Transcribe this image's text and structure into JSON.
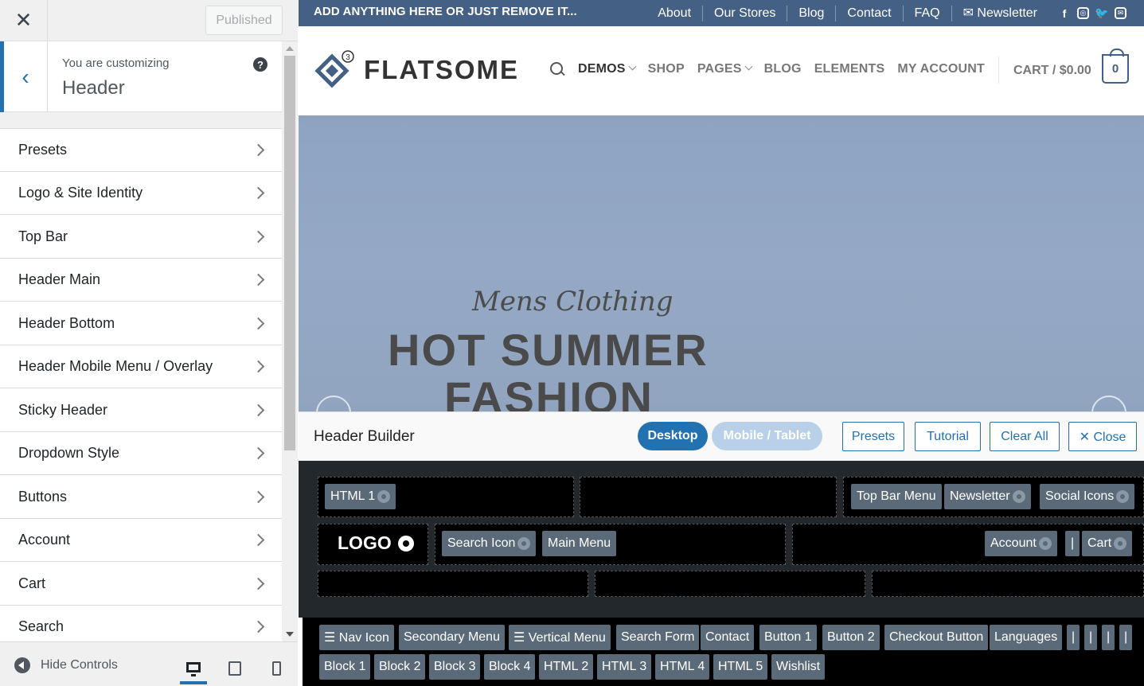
{
  "sidebar": {
    "close_icon": "close-icon",
    "published_label": "Published",
    "customizing_label": "You are customizing",
    "customizing_title": "Header",
    "help_glyph": "?",
    "sections": [
      "Presets",
      "Logo & Site Identity",
      "Top Bar",
      "Header Main",
      "Header Bottom",
      "Header Mobile Menu / Overlay",
      "Sticky Header",
      "Dropdown Style",
      "Buttons",
      "Account",
      "Cart",
      "Search"
    ],
    "footer": {
      "hide_label": "Hide Controls"
    },
    "accent_color": "#2271b1"
  },
  "preview": {
    "topbar": {
      "message": "ADD ANYTHING HERE OR JUST REMOVE IT...",
      "links": [
        "About",
        "Our Stores",
        "Blog",
        "Contact",
        "FAQ",
        "Newsletter"
      ],
      "newsletter_glyph": "✉",
      "social": [
        "f",
        "◎",
        "🐦",
        "✉"
      ],
      "bg_color": "#446084"
    },
    "header": {
      "logo_text": "FLATSOME",
      "logo_badge": "3",
      "nav": [
        "DEMOS",
        "SHOP",
        "PAGES",
        "BLOG",
        "ELEMENTS",
        "MY ACCOUNT"
      ],
      "cart_label": "CART / $0.00",
      "cart_count": "0"
    },
    "hero": {
      "script": "Mens Clothing",
      "title_line1": "HOT SUMMER",
      "title_line2": "FASHION"
    },
    "builder": {
      "title": "Header Builder",
      "desktop_label": "Desktop",
      "mobile_label": "Mobile / Tablet",
      "presets_label": "Presets",
      "tutorial_label": "Tutorial",
      "clear_label": "Clear All",
      "close_label": "✕ Close",
      "row1_left": [
        "HTML 1"
      ],
      "row1_right": [
        "Top Bar Menu",
        "Newsletter",
        "Social Icons"
      ],
      "logo_label": "LOGO",
      "row2_left": [
        "Search Icon",
        "Main Menu"
      ],
      "row2_right": [
        "Account",
        "|",
        "Cart"
      ],
      "library_row1": [
        "☰ Nav Icon",
        "Secondary Menu",
        "☰ Vertical Menu",
        "Search Form",
        "Contact",
        "Button 1",
        "Button 2",
        "Checkout Button",
        "Languages",
        "|",
        "|",
        "|",
        "|"
      ],
      "library_row2": [
        "Block 1",
        "Block 2",
        "Block 3",
        "Block 4",
        "HTML 2",
        "HTML 3",
        "HTML 4",
        "HTML 5",
        "Wishlist"
      ]
    }
  }
}
